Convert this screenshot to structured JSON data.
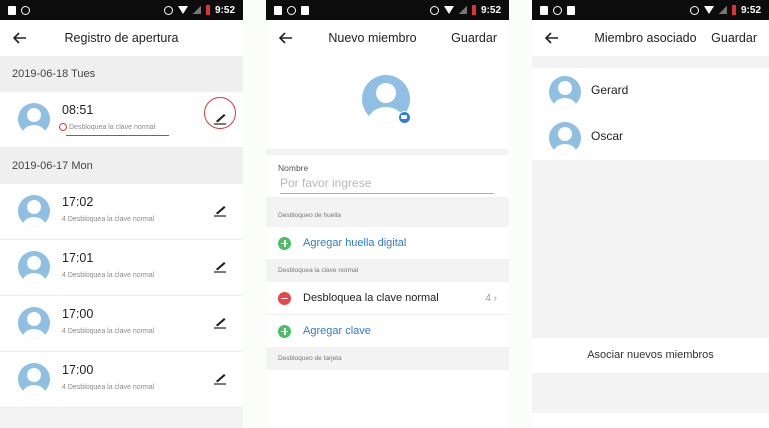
{
  "status_bar": {
    "time": "9:52"
  },
  "screen1": {
    "title": "Registro de apertura",
    "groups": [
      {
        "date": "2019-06-18 Tues",
        "records": [
          {
            "time": "08:51",
            "desc": "Desbloquea la clave normal",
            "prefix": ""
          }
        ]
      },
      {
        "date": "2019-06-17 Mon",
        "records": [
          {
            "time": "17:02",
            "desc": "Desbloquea la clave normal",
            "prefix": "4"
          },
          {
            "time": "17:01",
            "desc": "Desbloquea la clave normal",
            "prefix": "4"
          },
          {
            "time": "17:00",
            "desc": "Desbloquea la clave normal",
            "prefix": "4"
          },
          {
            "time": "17:00",
            "desc": "Desbloquea la clave normal",
            "prefix": "4"
          }
        ]
      }
    ]
  },
  "screen2": {
    "title": "Nuevo miembro",
    "action": "Guardar",
    "name_label": "Nombre",
    "name_placeholder": "Por favor ingrese",
    "fingerprint_section": "Desbloqueo de huella",
    "add_fingerprint": "Agregar huella digital",
    "password_section": "Desbloquea la clave normal",
    "password_item": "Desbloquea la clave normal",
    "password_item_count": "4",
    "add_password": "Agregar clave",
    "card_section": "Desbloqueo de tarjeta"
  },
  "screen3": {
    "title": "Miembro asociado",
    "action": "Guardar",
    "members": [
      "Gerard",
      "Oscar"
    ],
    "associate_button": "Asociar nuevos miembros"
  },
  "colors": {
    "accent_blue": "#2f7bd3",
    "avatar_blue": "#8fbfe3",
    "annotation_red": "#d23b3b",
    "input_underline": "#f0a04b",
    "add_green": "#4cbd64",
    "remove_red": "#e5464a"
  }
}
